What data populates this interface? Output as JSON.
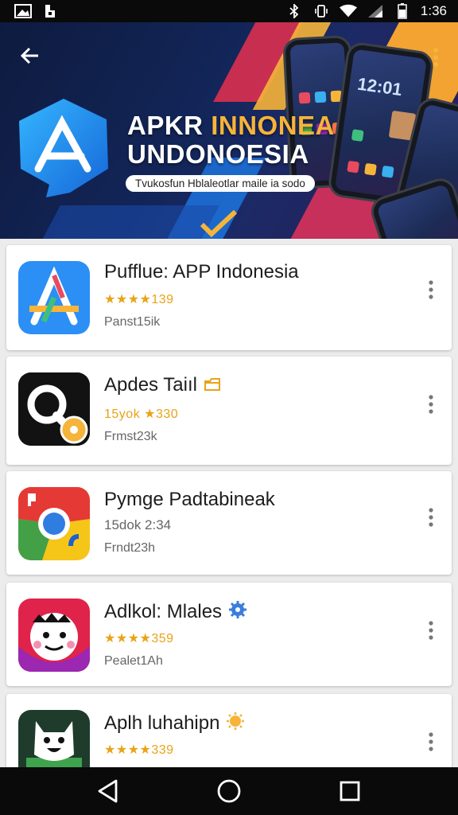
{
  "status_bar": {
    "time": "1:36",
    "icons": [
      "screenshot-icon",
      "notification-icon",
      "bluetooth-icon",
      "vibrate-icon",
      "wifi-icon",
      "signal-icon",
      "battery-icon"
    ]
  },
  "banner": {
    "title_line1_a": "APKR ",
    "title_line1_b": "INNONEA",
    "title_line2": "UNDONOESIA",
    "pill_text": "Tvukosfun Hblaleotlar maile ia sodo",
    "phone_clock": "12:01"
  },
  "apps": [
    {
      "name": "Pufflue: APP Indonesia",
      "rating": "★★★★139",
      "meta": "Panst15ik",
      "badge": ""
    },
    {
      "name": "Apdes Taiıl",
      "rating": "15yok ★330",
      "meta": "Frmst23k",
      "badge": "folder-badge-icon"
    },
    {
      "name": "Pymge Padtabineak",
      "rating": "15dok 2:34",
      "meta": "Frndt23h",
      "badge": ""
    },
    {
      "name": "Adlkol: Mlales",
      "rating": "★★★★359",
      "meta": "Pealet1Ah",
      "badge": "gear-badge-icon"
    },
    {
      "name": "Aplh luhahipn",
      "rating": "★★★★339",
      "meta": "",
      "badge": "sun-badge-icon"
    }
  ],
  "colors": {
    "banner_bg": "#13265a",
    "accent_orange": "#f6b43a",
    "star": "#e8a317",
    "logo_blue": "#1e8ff0"
  }
}
